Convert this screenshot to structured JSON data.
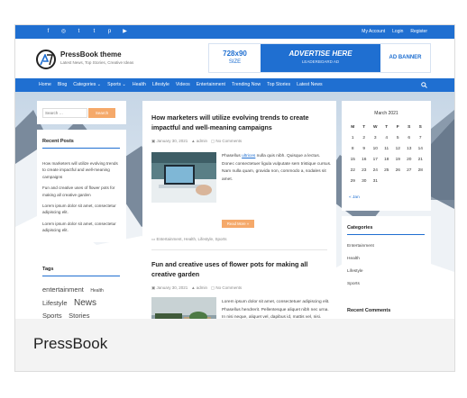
{
  "caption": "PressBook",
  "topbar": {
    "social_icons": [
      "facebook-icon",
      "instagram-icon",
      "twitter-icon",
      "tumblr-icon",
      "pinterest-icon",
      "youtube-icon"
    ],
    "links": [
      "My Account",
      "Login",
      "Register"
    ]
  },
  "header": {
    "site_title": "PressBook theme",
    "tagline": "Latest News, Top Stories, Creative Ideas"
  },
  "ad": {
    "size_a": "728x90",
    "size_b": "SIZE",
    "main_a": "ADVERTISE HERE",
    "main_b": "LEADERBOARD AD",
    "banner": "AD BANNER"
  },
  "nav": {
    "items": [
      "Home",
      "Blog",
      "Categories ⌄",
      "Sports ⌄",
      "Health",
      "Lifestyle",
      "Videos",
      "Entertainment",
      "Trending Now",
      "Top Stories",
      "Latest News"
    ]
  },
  "search": {
    "placeholder": "Search …",
    "button": "Search"
  },
  "recent_posts": {
    "title": "Recent Posts",
    "items": [
      "How marketers will utilize evolving trends to create impactful and well-meaning campaigns",
      "Fun and creative uses of flower pots for making all creative garden",
      "Lorem ipsum dolor sit amet, consectetur adipiscing elit.",
      "Lorem ipsum dolor sit amet, consectetur adipiscing elit."
    ]
  },
  "tags": {
    "title": "Tags",
    "items": [
      "entertainment",
      "Health",
      "Lifestyle",
      "News",
      "Sports",
      "Stories"
    ]
  },
  "posts": [
    {
      "title": "How marketers will utilize evolving trends to create impactful and well-meaning campaigns",
      "date": "January 30, 2021",
      "author": "admin",
      "comments": "No Comments",
      "excerpt_a": "Phasellus ",
      "excerpt_link": "ultrices",
      "excerpt_b": " nulla quis nibh. Quisque a lectus. Donec consectetuer ligula vulputate sem tristique cursus. Nam nulla quam, gravida non, commodo a, sodales sit amet.",
      "readmore": "Read More »",
      "cats": "Entertainment, Health, Lifestyle, Sports"
    },
    {
      "title": "Fun and creative uses of flower pots for making all creative garden",
      "date": "January 30, 2021",
      "author": "admin",
      "comments": "No Comments",
      "excerpt": "Lorem ipsum dolor sit amet, consectetuer adipiscing elit. Phasellus hendrerit. Pellentesque aliquet nibh nec urna. In nisi neque, aliquet vel, dapibus id, mattis vel, nisi."
    }
  ],
  "calendar": {
    "title": "March 2021",
    "headers": [
      "M",
      "T",
      "W",
      "T",
      "F",
      "S",
      "S"
    ],
    "rows": [
      [
        "1",
        "2",
        "3",
        "4",
        "5",
        "6",
        "7"
      ],
      [
        "8",
        "9",
        "10",
        "11",
        "12",
        "13",
        "14"
      ],
      [
        "15",
        "16",
        "17",
        "18",
        "19",
        "20",
        "21"
      ],
      [
        "22",
        "23",
        "24",
        "25",
        "26",
        "27",
        "28"
      ],
      [
        "29",
        "30",
        "31",
        "",
        "",
        "",
        ""
      ]
    ],
    "prev": "« Jan"
  },
  "categories": {
    "title": "Categories",
    "items": [
      "Entertainment",
      "Health",
      "Lifestyle",
      "Sports"
    ]
  },
  "recent_comments": {
    "title": "Recent Comments"
  },
  "colors": {
    "primary": "#1f6fd1",
    "accent": "#f5a96a"
  }
}
